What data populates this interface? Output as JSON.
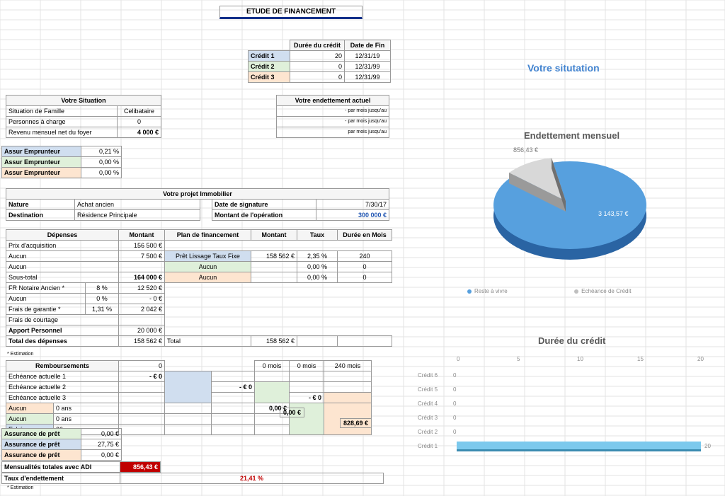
{
  "title": "ETUDE DE FINANCEMENT",
  "credits_header": {
    "c1": "Durée du crédit",
    "c2": "Date de Fin"
  },
  "credits": [
    {
      "name": "Crédit 1",
      "dur": "20",
      "end": "12/31/19"
    },
    {
      "name": "Crédit 2",
      "dur": "0",
      "end": "12/31/99"
    },
    {
      "name": "Crédit 3",
      "dur": "0",
      "end": "12/31/99"
    }
  ],
  "situation": {
    "header": "Votre Situation",
    "rows": [
      {
        "l": "Situation de Famille",
        "v": "Celibataire"
      },
      {
        "l": "Personnes à charge",
        "v": "0"
      },
      {
        "l": "Revenu mensuel net du foyer",
        "v": "4 000 €"
      }
    ]
  },
  "endett_actuel": {
    "header": "Votre endettement actuel",
    "rows": [
      "- par mois jusqu'au",
      "- par mois jusqu'au",
      "par mois jusqu'au"
    ]
  },
  "assur": [
    {
      "l": "Assur Emprunteur",
      "v": "0,21 %"
    },
    {
      "l": "Assur Emprunteur",
      "v": "0,00 %"
    },
    {
      "l": "Assur Emprunteur",
      "v": "0,00 %"
    }
  ],
  "projet": {
    "header": "Votre projet Immobilier",
    "nature_l": "Nature",
    "nature_v": "Achat ancien",
    "dest_l": "Destination",
    "dest_v": "Résidence Principale",
    "date_l": "Date de signature",
    "date_v": "7/30/17",
    "mont_l": "Montant de l'opération",
    "mont_v": "300 000 €"
  },
  "dep_hdr": {
    "a": "Dépenses",
    "b": "Montant",
    "c": "Plan de financement",
    "d": "Montant",
    "e": "Taux",
    "f": "Durée en Mois"
  },
  "dep": [
    {
      "l": "Prix d'acquisition",
      "m": "156 500 €"
    },
    {
      "l": "Aucun",
      "m": "7 500 €",
      "plan": "Prêt Lissage Taux Fixe",
      "pm": "158 562 €",
      "tx": "2,35 %",
      "dur": "240"
    },
    {
      "l": "Aucun",
      "m": "",
      "plan": "Aucun",
      "pm": "",
      "tx": "0,00 %",
      "dur": "0"
    },
    {
      "l": "Sous-total",
      "m": "164 000 €",
      "plan": "Aucun",
      "pm": "",
      "tx": "0,00 %",
      "dur": "0"
    },
    {
      "l": "FR Notaire Ancien *",
      "pct": "8 %",
      "m": "12 520 €"
    },
    {
      "l": "Aucun",
      "pct": "0 %",
      "m": "- 0 €"
    },
    {
      "l": "Frais de garantie *",
      "pct": "1,31 %",
      "m": "2 042 €"
    },
    {
      "l": "Frais de courtage",
      "m": ""
    },
    {
      "l": "Apport Personnel",
      "m": "20 000 €"
    },
    {
      "l": "Total des dépenses",
      "m": "158 562 €",
      "plan": "Total",
      "pm": "158 562 €"
    }
  ],
  "estim": "* Estimation",
  "remb": {
    "header": "Remboursements",
    "zero": "0",
    "zmois": "0 mois",
    "d240": "240 mois",
    "rows": [
      {
        "l": "Echéance actuelle 1",
        "v": "- € 0"
      },
      {
        "l": "Echéance actuelle 2",
        "v": "- € 0"
      },
      {
        "l": "Echéance actuelle 3",
        "v": "- € 0"
      }
    ],
    "aucun": [
      {
        "l": "Aucun",
        "y": "0 ans",
        "v": "0,00 €"
      },
      {
        "l": "Aucun",
        "y": "0 ans",
        "v": "0,00 €"
      },
      {
        "l": "Echéance",
        "y": "20 ans",
        "v": "828,69 €"
      }
    ],
    "assur": [
      {
        "l": "Assurance de prêt",
        "v": "0,00 €"
      },
      {
        "l": "Assurance de prêt",
        "v": "27,75 €"
      },
      {
        "l": "Assurance de prêt",
        "v": "0,00 €"
      }
    ],
    "total_l": "Mensualités totales avec ADI",
    "total_v": "856,43 €",
    "taux_l": "Taux d'endettement",
    "taux_v": "21,41 %"
  },
  "chart_side": {
    "title1": "Votre situtation",
    "title2": "Endettement mensuel",
    "title3": "Durée du crédit",
    "legend": {
      "a": "Reste à vivre",
      "b": "Echéance de Crédit"
    },
    "pie": {
      "a": "856,43 €",
      "b": "3 143,57 €"
    }
  },
  "chart_data": [
    {
      "type": "pie",
      "title": "Endettement mensuel",
      "series": [
        {
          "name": "Echéance de Crédit",
          "value": 856.43
        },
        {
          "name": "Reste à vivre",
          "value": 3143.57
        }
      ]
    },
    {
      "type": "bar",
      "title": "Durée du crédit",
      "orientation": "horizontal",
      "xlim": [
        0,
        20
      ],
      "xticks": [
        0,
        5,
        10,
        15,
        20
      ],
      "categories": [
        "Crédit 1",
        "Crédit 2",
        "Crédit 3",
        "Crédit 4",
        "Crédit 5",
        "Crédit 6"
      ],
      "values": [
        20,
        0,
        0,
        0,
        0,
        0
      ]
    }
  ]
}
